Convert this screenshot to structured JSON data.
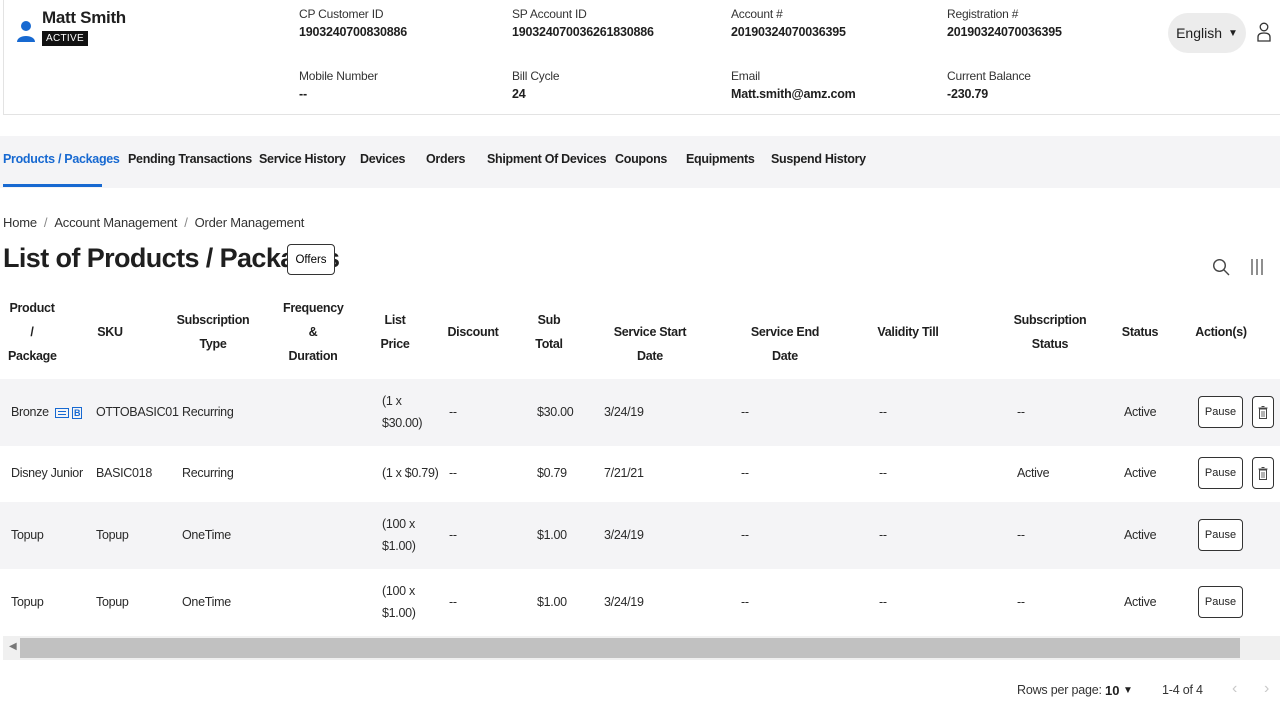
{
  "header": {
    "user_name": "Matt Smith",
    "status": "ACTIVE",
    "fields": {
      "cp_customer_id": {
        "label": "CP Customer ID",
        "value": "1903240700830886"
      },
      "sp_account_id": {
        "label": "SP Account ID",
        "value": "190324070036261830886"
      },
      "account_number": {
        "label": "Account #",
        "value": "20190324070036395"
      },
      "registration_number": {
        "label": "Registration #",
        "value": "20190324070036395"
      },
      "mobile_number": {
        "label": "Mobile Number",
        "value": "--"
      },
      "bill_cycle": {
        "label": "Bill Cycle",
        "value": "24"
      },
      "email": {
        "label": "Email",
        "value": "Matt.smith@amz.com"
      },
      "current_balance": {
        "label": "Current Balance",
        "value": "-230.79"
      }
    },
    "language": "English"
  },
  "tabs": [
    {
      "label": "Products / Packages",
      "active": true
    },
    {
      "label": "Pending Transactions"
    },
    {
      "label": "Service History"
    },
    {
      "label": "Devices"
    },
    {
      "label": "Orders"
    },
    {
      "label": "Shipment Of Devices"
    },
    {
      "label": "Coupons"
    },
    {
      "label": "Equipments"
    },
    {
      "label": "Suspend History"
    }
  ],
  "breadcrumb": [
    "Home",
    "Account Management",
    "Order Management"
  ],
  "page": {
    "title": "List of Products / Packages",
    "offers_label": "Offers"
  },
  "table": {
    "headers": {
      "product": [
        "Product",
        "/",
        "Package"
      ],
      "sku": [
        "SKU"
      ],
      "subscription_type": [
        "Subscription",
        "Type"
      ],
      "frequency": [
        "Frequency",
        "&",
        "Duration"
      ],
      "list_price": [
        "List",
        "Price"
      ],
      "discount": [
        "Discount"
      ],
      "sub_total": [
        "Sub",
        "Total"
      ],
      "service_start": [
        "Service Start Date"
      ],
      "service_end": [
        "Service End Date"
      ],
      "validity": [
        "Validity Till"
      ],
      "subscription_status": [
        "Subscription",
        "Status"
      ],
      "status": [
        "Status"
      ],
      "actions": [
        "Action(s)"
      ]
    },
    "rows": [
      {
        "product": "Bronze",
        "sku": "OTTOBASIC01",
        "type": "Recurring",
        "frequency": "",
        "list_price": "(1 x $30.00)",
        "discount": "--",
        "sub_total": "$30.00",
        "start": "3/24/19",
        "end": "--",
        "validity": "--",
        "sub_status": "--",
        "status": "Active",
        "pause": "Pause"
      },
      {
        "product": "Disney Junior",
        "sku": "BASIC018",
        "type": "Recurring",
        "frequency": "",
        "list_price": "(1 x $0.79)",
        "discount": "--",
        "sub_total": "$0.79",
        "start": "7/21/21",
        "end": "--",
        "validity": "--",
        "sub_status": "Active",
        "status": "Active",
        "pause": "Pause"
      },
      {
        "product": "Topup",
        "sku": "Topup",
        "type": "OneTime",
        "frequency": "",
        "list_price": "(100 x $1.00)",
        "discount": "--",
        "sub_total": "$1.00",
        "start": "3/24/19",
        "end": "--",
        "validity": "--",
        "sub_status": "--",
        "status": "Active",
        "pause": "Pause"
      },
      {
        "product": "Topup",
        "sku": "Topup",
        "type": "OneTime",
        "frequency": "",
        "list_price": "(100 x $1.00)",
        "discount": "--",
        "sub_total": "$1.00",
        "start": "3/24/19",
        "end": "--",
        "validity": "--",
        "sub_status": "--",
        "status": "Active",
        "pause": "Pause"
      }
    ]
  },
  "pagination": {
    "rows_per_page_label": "Rows per page:",
    "rows_per_page": "10",
    "range": "1-4 of 4"
  },
  "colors": {
    "accent": "#1769d1",
    "shaded_row": "#f4f4f6"
  }
}
